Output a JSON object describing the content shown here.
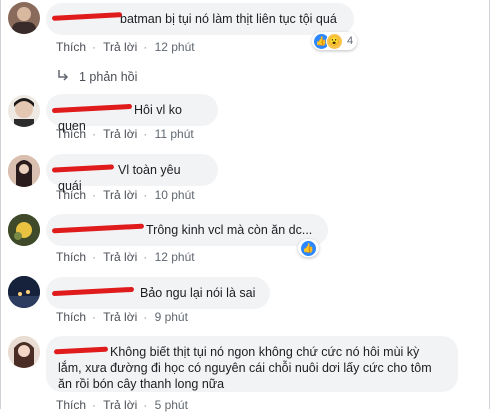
{
  "comments": [
    {
      "text": "batman bị tụi nó làm thịt liên tục tội quá",
      "like": "Thích",
      "reply": "Trả lời",
      "time": "12 phút",
      "reaction_count": "4"
    },
    {
      "text": "Hôi vl ko quen",
      "like": "Thích",
      "reply": "Trả lời",
      "time": "11 phút"
    },
    {
      "text": "Vl toàn yêu quái",
      "like": "Thích",
      "reply": "Trả lời",
      "time": "10 phút"
    },
    {
      "text": "Trông kinh vcl mà còn ăn dc...",
      "like": "Thích",
      "reply": "Trả lời",
      "time": "12 phút"
    },
    {
      "text": "Bảo ngu lại nói là sai",
      "like": "Thích",
      "reply": "Trả lời",
      "time": "9 phút"
    },
    {
      "text_line1": "Không biết thịt tụi nó ngon không chứ cức nó hôi mùi kỳ",
      "text_line2": "lắm, xưa đường đi học có nguyên cái chỗi nuôi dơi lấy cức cho tôm",
      "text_line3": "ăn rồi bón cây thanh long nữa",
      "like": "Thích",
      "reply": "Trả lời",
      "time": "5 phút"
    }
  ],
  "replies_link": "1 phản hồi",
  "colors": {
    "bubble": "#f2f3f5",
    "redaction": "#e01b1b",
    "link": "#385898"
  }
}
